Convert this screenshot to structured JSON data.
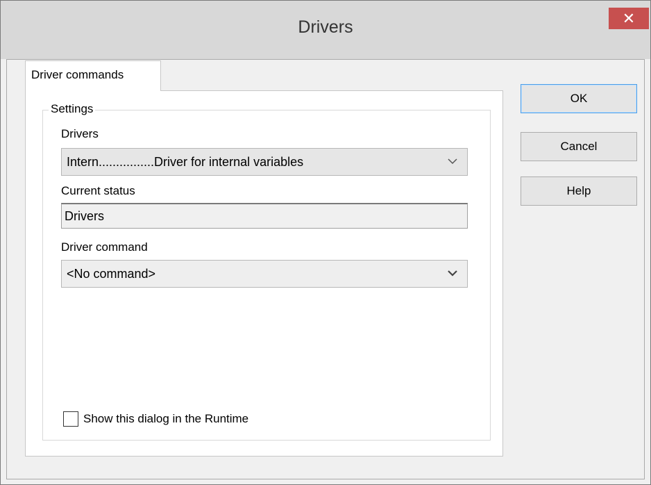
{
  "window": {
    "title": "Drivers",
    "close_glyph": "✕",
    "close_icon": "close-icon"
  },
  "tabs": [
    {
      "label": "Driver commands",
      "active": true
    }
  ],
  "settings": {
    "group_label": "Settings",
    "drivers_label": "Drivers",
    "drivers_value": "Intern................Driver for internal variables",
    "status_label": "Current status",
    "status_value": "Drivers",
    "command_label": "Driver command",
    "command_value": "<No command>",
    "runtime_checkbox_label": "Show this dialog in the Runtime",
    "runtime_checkbox_checked": false
  },
  "buttons": {
    "ok": "OK",
    "cancel": "Cancel",
    "help": "Help"
  },
  "colors": {
    "close_button": "#c7504f",
    "focus_border": "#4f9ee5"
  }
}
